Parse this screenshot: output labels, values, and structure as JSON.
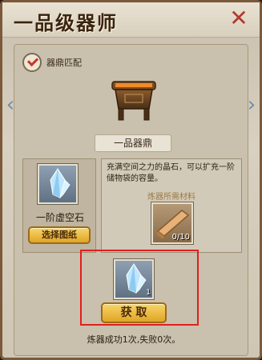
{
  "window": {
    "title": "一品级器师",
    "close_label": "✕"
  },
  "subheader": {
    "label": "器鼎匹配"
  },
  "navigation": {
    "prev_label": "‹",
    "next_label": "›"
  },
  "item": {
    "name": "一品器鼎",
    "icon": "cauldron-icon"
  },
  "left_panel": {
    "name": "一阶虚空石",
    "icon": "crystal-icon",
    "button_label": "选择图纸"
  },
  "right_panel": {
    "description": "充满空间之力的晶石，可以扩充一阶储物袋的容量。",
    "material_label": "炼器所需材料",
    "material_icon": "material-plank-icon",
    "material_count": "0/10"
  },
  "result": {
    "icon": "crystal-icon",
    "count": "1",
    "button_label": "获 取"
  },
  "status": {
    "text": "炼器成功1次,失败0次。"
  },
  "colors": {
    "highlight": "#e21e1e",
    "gold_button": "#f0c24a",
    "title": "#3a2410"
  }
}
